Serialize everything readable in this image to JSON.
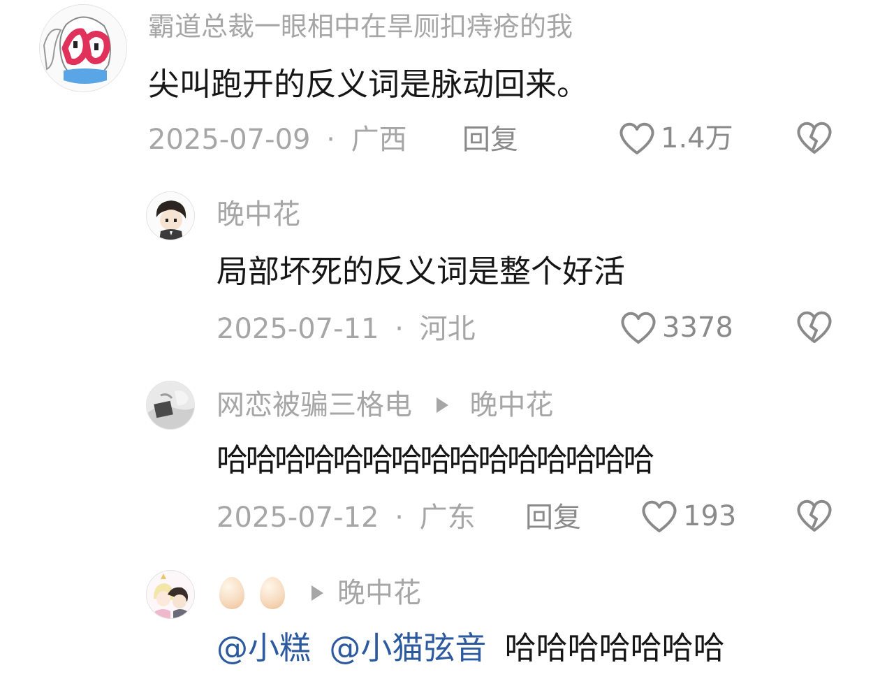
{
  "comments": [
    {
      "username": "霸道总裁一眼相中在旱厕扣痔疮的我",
      "text": "尖叫跑开的反义词是脉动回来。",
      "date": "2025-07-09",
      "location": "广西",
      "reply_label": "回复",
      "likes": "1.4万"
    }
  ],
  "replies": [
    {
      "username": "晚中花",
      "text": "局部坏死的反义词是整个好活",
      "date": "2025-07-11",
      "location": "河北",
      "likes": "3378"
    },
    {
      "username": "网恋被骗三格电",
      "reply_to": "晚中花",
      "text": "哈哈哈哈哈哈哈哈哈哈哈哈哈哈哈",
      "date": "2025-07-12",
      "location": "广东",
      "reply_label": "回复",
      "likes": "193"
    },
    {
      "username_emoji": [
        "egg-emoji",
        "egg-emoji"
      ],
      "reply_to": "晚中花",
      "mentions": [
        "@小糕",
        "@小猫弦音"
      ],
      "text": "哈哈哈哈哈哈哈"
    }
  ],
  "separator": "·",
  "icons": {
    "like": "heart-outline-icon",
    "dislike": "broken-heart-icon",
    "reply_arrow": "triangle-right-icon"
  },
  "colors": {
    "text_primary": "#161616",
    "text_secondary": "#a6a6a6",
    "mention": "#2d5a9e"
  }
}
